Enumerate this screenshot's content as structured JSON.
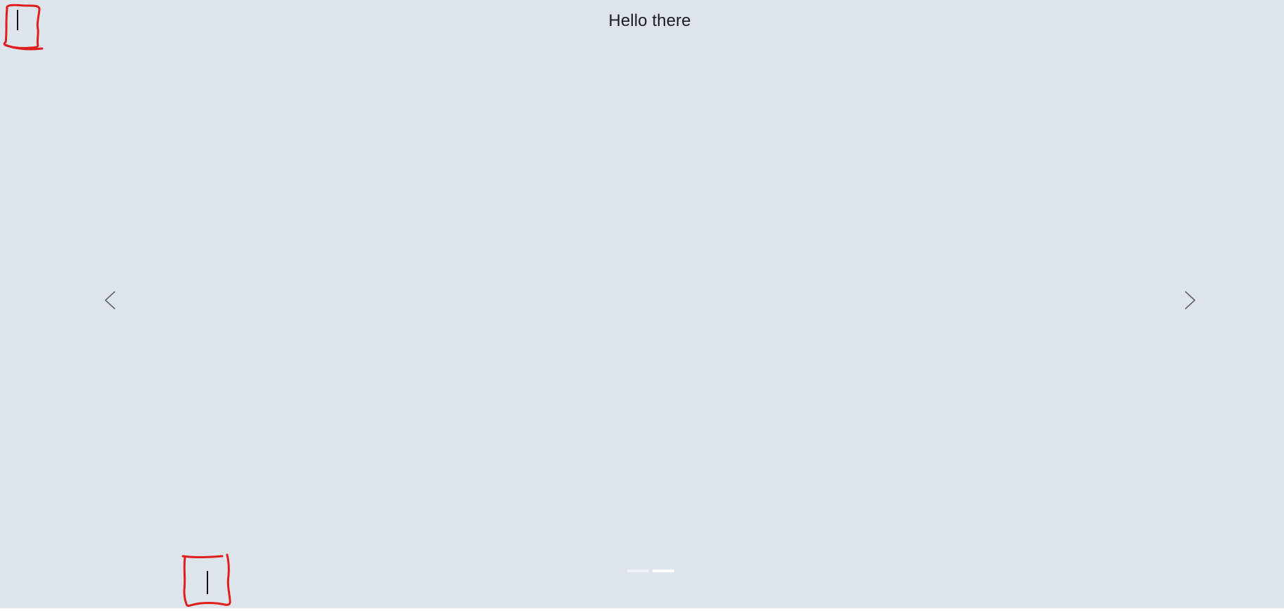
{
  "slide": {
    "title": "Hello there"
  },
  "carousel": {
    "prev_icon": "chevron-left-icon",
    "next_icon": "chevron-right-icon",
    "indicators": [
      {
        "state": "inactive"
      },
      {
        "state": "active"
      }
    ]
  },
  "colors": {
    "background": "#dee4eb",
    "title_text": "#1a1d21",
    "arrow": "#5f6469",
    "indicator_active": "#ffffff",
    "indicator_inactive": "#eef1f5",
    "annotation": "#e01e1e"
  }
}
